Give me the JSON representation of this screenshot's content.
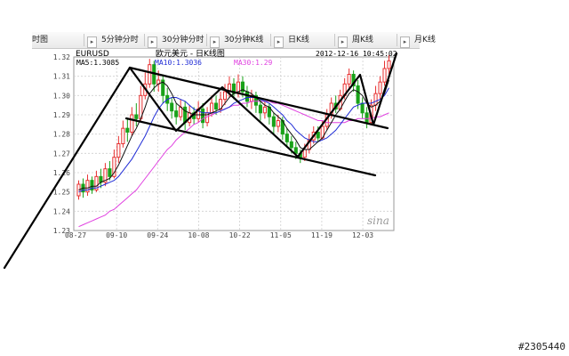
{
  "tabs": [
    {
      "label": "时图",
      "arrow": false
    },
    {
      "label": "5分钟分时",
      "arrow": true
    },
    {
      "label": "30分钟分时",
      "arrow": true
    },
    {
      "label": "30分钟K线",
      "arrow": true
    },
    {
      "label": "日K线",
      "arrow": true
    },
    {
      "label": "周K线",
      "arrow": true
    },
    {
      "label": "月K线",
      "arrow": true
    }
  ],
  "header": {
    "symbol": "EURUSD",
    "title": "欧元美元 - 日K线图",
    "datetime": "2012-12-16 10:45:02",
    "ma5": "MA5:1.3085",
    "ma10": "MA10:1.3036",
    "ma30": "MA30:1.29"
  },
  "logo_text": "sina",
  "watermark": "#2305440",
  "colors": {
    "up": "#e83030",
    "down": "#19a219",
    "ma5": "#111111",
    "ma10": "#1f2bd6",
    "ma30": "#e040e0",
    "grid": "#cfcfcf",
    "trendline": "#000000"
  },
  "chart_data": {
    "type": "candlestick",
    "ylim": [
      1.23,
      1.32
    ],
    "yticks": [
      1.23,
      1.24,
      1.25,
      1.26,
      1.27,
      1.28,
      1.29,
      1.3,
      1.31,
      1.32
    ],
    "xticks": [
      "08-27",
      "09-10",
      "09-24",
      "10-08",
      "10-22",
      "11-05",
      "11-19",
      "12-03"
    ],
    "candles": [
      [
        1.248,
        1.254,
        1.246,
        1.256
      ],
      [
        1.254,
        1.25,
        1.247,
        1.257
      ],
      [
        1.25,
        1.256,
        1.248,
        1.259
      ],
      [
        1.256,
        1.251,
        1.249,
        1.258
      ],
      [
        1.251,
        1.258,
        1.25,
        1.261
      ],
      [
        1.258,
        1.255,
        1.252,
        1.262
      ],
      [
        1.255,
        1.262,
        1.253,
        1.265
      ],
      [
        1.262,
        1.258,
        1.256,
        1.266
      ],
      [
        1.258,
        1.268,
        1.257,
        1.272
      ],
      [
        1.268,
        1.275,
        1.265,
        1.279
      ],
      [
        1.275,
        1.283,
        1.273,
        1.287
      ],
      [
        1.283,
        1.281,
        1.276,
        1.288
      ],
      [
        1.281,
        1.29,
        1.279,
        1.294
      ],
      [
        1.29,
        1.288,
        1.284,
        1.296
      ],
      [
        1.288,
        1.3,
        1.287,
        1.305
      ],
      [
        1.3,
        1.306,
        1.298,
        1.312
      ],
      [
        1.306,
        1.316,
        1.304,
        1.319
      ],
      [
        1.316,
        1.306,
        1.302,
        1.318
      ],
      [
        1.306,
        1.308,
        1.302,
        1.313
      ],
      [
        1.308,
        1.3,
        1.296,
        1.311
      ],
      [
        1.3,
        1.296,
        1.292,
        1.304
      ],
      [
        1.296,
        1.292,
        1.288,
        1.299
      ],
      [
        1.292,
        1.289,
        1.285,
        1.296
      ],
      [
        1.289,
        1.294,
        1.287,
        1.298
      ],
      [
        1.294,
        1.286,
        1.282,
        1.297
      ],
      [
        1.286,
        1.291,
        1.284,
        1.295
      ],
      [
        1.291,
        1.288,
        1.285,
        1.294
      ],
      [
        1.288,
        1.293,
        1.286,
        1.297
      ],
      [
        1.293,
        1.286,
        1.283,
        1.296
      ],
      [
        1.286,
        1.291,
        1.284,
        1.294
      ],
      [
        1.291,
        1.296,
        1.289,
        1.3
      ],
      [
        1.296,
        1.293,
        1.29,
        1.3
      ],
      [
        1.293,
        1.298,
        1.291,
        1.302
      ],
      [
        1.298,
        1.302,
        1.295,
        1.306
      ],
      [
        1.302,
        1.306,
        1.299,
        1.31
      ],
      [
        1.306,
        1.301,
        1.298,
        1.309
      ],
      [
        1.301,
        1.307,
        1.299,
        1.311
      ],
      [
        1.307,
        1.302,
        1.299,
        1.31
      ],
      [
        1.302,
        1.297,
        1.294,
        1.305
      ],
      [
        1.297,
        1.3,
        1.293,
        1.303
      ],
      [
        1.3,
        1.295,
        1.291,
        1.302
      ],
      [
        1.295,
        1.291,
        1.287,
        1.298
      ],
      [
        1.291,
        1.294,
        1.288,
        1.297
      ],
      [
        1.294,
        1.289,
        1.285,
        1.296
      ],
      [
        1.289,
        1.284,
        1.28,
        1.291
      ],
      [
        1.284,
        1.287,
        1.281,
        1.29
      ],
      [
        1.287,
        1.28,
        1.277,
        1.289
      ],
      [
        1.28,
        1.276,
        1.273,
        1.283
      ],
      [
        1.276,
        1.273,
        1.27,
        1.279
      ],
      [
        1.273,
        1.27,
        1.267,
        1.276
      ],
      [
        1.27,
        1.268,
        1.265,
        1.272
      ],
      [
        1.268,
        1.272,
        1.266,
        1.275
      ],
      [
        1.272,
        1.277,
        1.27,
        1.28
      ],
      [
        1.277,
        1.281,
        1.275,
        1.284
      ],
      [
        1.281,
        1.278,
        1.276,
        1.284
      ],
      [
        1.278,
        1.284,
        1.277,
        1.287
      ],
      [
        1.284,
        1.29,
        1.282,
        1.293
      ],
      [
        1.29,
        1.296,
        1.288,
        1.299
      ],
      [
        1.296,
        1.293,
        1.291,
        1.3
      ],
      [
        1.293,
        1.3,
        1.292,
        1.303
      ],
      [
        1.3,
        1.306,
        1.298,
        1.309
      ],
      [
        1.306,
        1.311,
        1.304,
        1.314
      ],
      [
        1.311,
        1.305,
        1.302,
        1.313
      ],
      [
        1.305,
        1.296,
        1.293,
        1.308
      ],
      [
        1.296,
        1.291,
        1.288,
        1.299
      ],
      [
        1.291,
        1.286,
        1.283,
        1.294
      ],
      [
        1.286,
        1.295,
        1.285,
        1.298
      ],
      [
        1.295,
        1.301,
        1.292,
        1.305
      ],
      [
        1.301,
        1.307,
        1.298,
        1.31
      ],
      [
        1.307,
        1.314,
        1.305,
        1.318
      ],
      [
        1.314,
        1.318,
        1.311,
        1.321
      ]
    ],
    "ma5": [
      1.251,
      1.252,
      1.252,
      1.253,
      1.253,
      1.255,
      1.256,
      1.257,
      1.26,
      1.264,
      1.269,
      1.274,
      1.279,
      1.283,
      1.288,
      1.294,
      1.301,
      1.304,
      1.306,
      1.307,
      1.305,
      1.301,
      1.296,
      1.294,
      1.292,
      1.291,
      1.29,
      1.29,
      1.29,
      1.29,
      1.291,
      1.292,
      1.293,
      1.296,
      1.299,
      1.301,
      1.302,
      1.303,
      1.302,
      1.301,
      1.299,
      1.297,
      1.295,
      1.294,
      1.291,
      1.289,
      1.287,
      1.283,
      1.28,
      1.277,
      1.273,
      1.272,
      1.272,
      1.274,
      1.276,
      1.278,
      1.282,
      1.286,
      1.29,
      1.293,
      1.297,
      1.301,
      1.303,
      1.302,
      1.3,
      1.296,
      1.294,
      1.295,
      1.297,
      1.301,
      1.308
    ],
    "ma10": [
      1.25,
      1.251,
      1.251,
      1.252,
      1.252,
      1.253,
      1.254,
      1.255,
      1.256,
      1.258,
      1.261,
      1.264,
      1.267,
      1.271,
      1.275,
      1.279,
      1.284,
      1.289,
      1.293,
      1.296,
      1.298,
      1.299,
      1.299,
      1.298,
      1.297,
      1.295,
      1.293,
      1.292,
      1.291,
      1.291,
      1.291,
      1.291,
      1.292,
      1.293,
      1.294,
      1.296,
      1.297,
      1.298,
      1.299,
      1.299,
      1.299,
      1.298,
      1.297,
      1.296,
      1.294,
      1.292,
      1.29,
      1.287,
      1.285,
      1.282,
      1.28,
      1.278,
      1.277,
      1.276,
      1.276,
      1.277,
      1.278,
      1.28,
      1.282,
      1.285,
      1.288,
      1.291,
      1.294,
      1.295,
      1.296,
      1.296,
      1.296,
      1.297,
      1.298,
      1.3,
      1.304
    ],
    "ma30": [
      1.232,
      1.233,
      1.234,
      1.235,
      1.236,
      1.237,
      1.238,
      1.24,
      1.241,
      1.243,
      1.245,
      1.247,
      1.249,
      1.251,
      1.254,
      1.257,
      1.26,
      1.263,
      1.266,
      1.269,
      1.272,
      1.274,
      1.277,
      1.279,
      1.281,
      1.283,
      1.285,
      1.286,
      1.288,
      1.289,
      1.29,
      1.291,
      1.292,
      1.293,
      1.294,
      1.295,
      1.295,
      1.296,
      1.296,
      1.297,
      1.297,
      1.297,
      1.297,
      1.297,
      1.296,
      1.296,
      1.295,
      1.294,
      1.293,
      1.292,
      1.291,
      1.29,
      1.289,
      1.288,
      1.287,
      1.287,
      1.286,
      1.286,
      1.286,
      1.286,
      1.286,
      1.287,
      1.287,
      1.288,
      1.288,
      1.288,
      1.288,
      1.289,
      1.289,
      1.29,
      1.291
    ]
  }
}
